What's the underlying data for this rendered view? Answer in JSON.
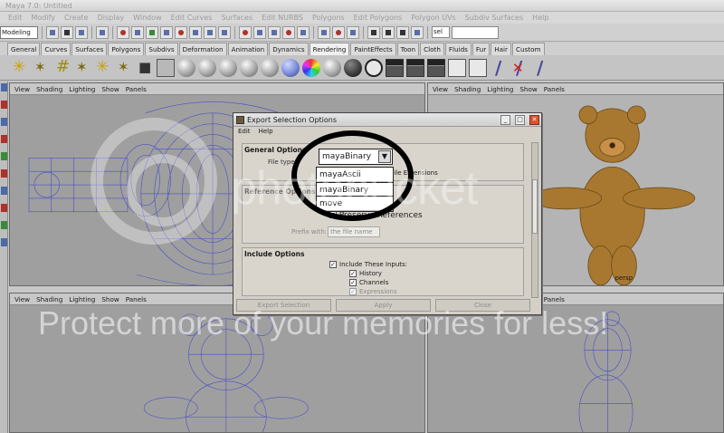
{
  "window": {
    "title": "Maya 7.0: Untitled"
  },
  "menubar": [
    "Edit",
    "Modify",
    "Create",
    "Display",
    "Window",
    "Edit Curves",
    "Surfaces",
    "Edit NURBS",
    "Polygons",
    "Edit Polygons",
    "Polygon UVs",
    "Subdiv Surfaces",
    "Help"
  ],
  "statusline": {
    "mode": "Modeling",
    "sel_field": "sel"
  },
  "shelf_tabs": [
    "General",
    "Curves",
    "Surfaces",
    "Polygons",
    "Subdivs",
    "Deformation",
    "Animation",
    "Dynamics",
    "Rendering",
    "PaintEffects",
    "Toon",
    "Cloth",
    "Fluids",
    "Fur",
    "Hair",
    "Custom"
  ],
  "shelf_active_tab": "Rendering",
  "viewports": {
    "panel_menu": [
      "View",
      "Shading",
      "Lighting",
      "Show",
      "Panels"
    ],
    "persp_label": "persp"
  },
  "dialog": {
    "title": "Export Selection Options",
    "menu": [
      "Edit",
      "Help"
    ],
    "general_options": "General Options",
    "file_type_label": "File type",
    "file_type_value": "mayaBinary",
    "file_type_options": [
      "mayaAscii",
      "mayaBinary",
      "move"
    ],
    "default_extension_label": "Default File Extensions",
    "reference_options": "Reference Options",
    "preserve_references": "Preserve References",
    "prefix_with_label": "Prefix with:",
    "prefix_with_value": "the file name",
    "include_options": "Include Options",
    "include_inputs": "Include These Inputs:",
    "history": "History",
    "channels": "Channels",
    "expressions": "Expressions",
    "buttons": {
      "export": "Export Selection",
      "apply": "Apply",
      "close": "Close"
    }
  },
  "watermark": {
    "brand": "photobucket",
    "protect": "Protect more of your memories for less!"
  }
}
